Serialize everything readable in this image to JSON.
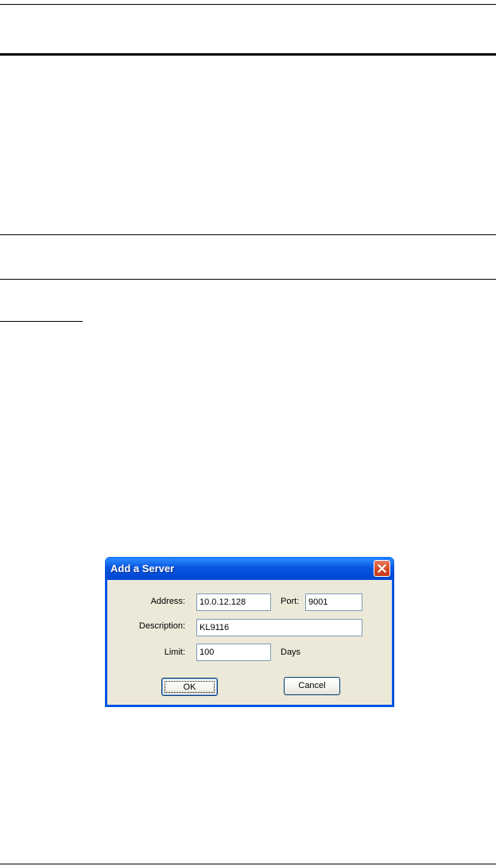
{
  "dialog": {
    "title": "Add a Server",
    "close_icon": "close-icon",
    "fields": {
      "address": {
        "label": "Address:",
        "value": "10.0.12.128"
      },
      "port": {
        "label": "Port:",
        "value": "9001"
      },
      "description": {
        "label": "Description:",
        "value": "KL9116"
      },
      "limit": {
        "label": "Limit:",
        "value": "100",
        "unit": "Days"
      }
    },
    "buttons": {
      "ok": "OK",
      "cancel": "Cancel"
    }
  },
  "colors": {
    "titlebar": "#0058e6",
    "dialog_body": "#ece9d8",
    "close_button": "#d64d2a",
    "field_border": "#7f9db9"
  }
}
